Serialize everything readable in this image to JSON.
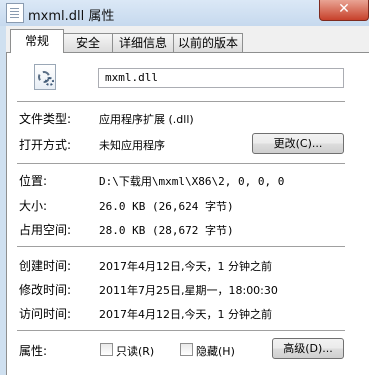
{
  "window": {
    "title": "mxml.dll 属性",
    "close_symbol": "✕"
  },
  "tabs": [
    {
      "label": "常规",
      "active": true
    },
    {
      "label": "安全",
      "active": false
    },
    {
      "label": "详细信息",
      "active": false
    },
    {
      "label": "以前的版本",
      "active": false
    }
  ],
  "file": {
    "name": "mxml.dll",
    "icon": "dll-settings-file-icon"
  },
  "type_section": {
    "file_type_label": "文件类型:",
    "file_type_value": "应用程序扩展 (.dll)",
    "open_with_label": "打开方式:",
    "open_with_value": "未知应用程序",
    "change_button": "更改(C)..."
  },
  "location_section": {
    "location_label": "位置:",
    "location_value": "D:\\下载用\\mxml\\X86\\2, 0, 0, 0",
    "size_label": "大小:",
    "size_value": "26.0 KB (26,624 字节)",
    "disk_size_label": "占用空间:",
    "disk_size_value": "28.0 KB (28,672 字节)"
  },
  "time_section": {
    "created_label": "创建时间:",
    "created_value": "2017年4月12日,今天，1 分钟之前",
    "modified_label": "修改时间:",
    "modified_value": "2011年7月25日,星期一，18:00:30",
    "accessed_label": "访问时间:",
    "accessed_value": "2017年4月12日,今天，1 分钟之前"
  },
  "attributes": {
    "label": "属性:",
    "readonly_label": "只读(R)",
    "readonly_checked": false,
    "hidden_label": "隐藏(H)",
    "hidden_checked": false,
    "advanced_button": "高级(D)..."
  }
}
